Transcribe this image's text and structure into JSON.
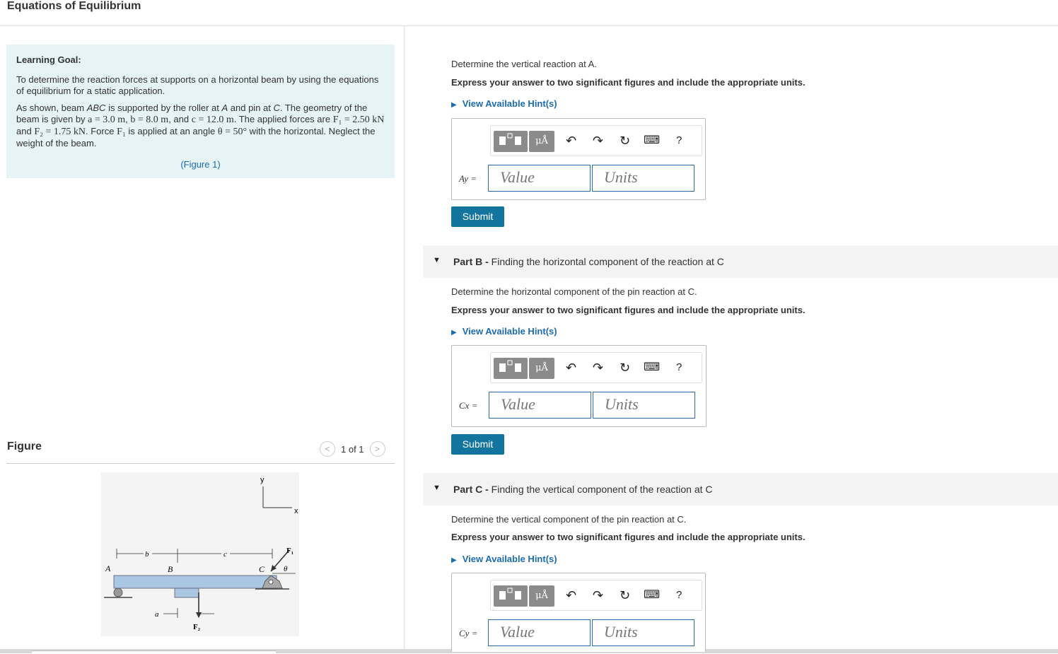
{
  "page_title": "Equations of Equilibrium",
  "learning_goal": {
    "heading": "Learning Goal:",
    "paragraph1": "To determine the reaction forces at supports on a horizontal beam by using the equations of equilibrium for a static application.",
    "p2_a": "As shown, beam ",
    "p2_abc": "ABC",
    "p2_b": " is supported by the roller at ",
    "p2_A": "A",
    "p2_c": " and pin at ",
    "p2_C": "C",
    "p2_d": ". The geometry of the beam is given by ",
    "p2_a_val": "a = 3.0 m",
    "p2_sep1": ", ",
    "p2_b_val": "b = 8.0 m",
    "p2_and": ", and ",
    "p2_c_val": "c = 12.0 m",
    "p2_e": ". The applied forces are ",
    "p2_F1": "F₁ = 2.50 kN",
    "p2_and2": " and ",
    "p2_F2": "F₂ = 1.75 kN",
    "p2_f": ". Force ",
    "p2_F1b": "F₁",
    "p2_g": " is applied at an angle ",
    "p2_theta": "θ = 50°",
    "p2_h": " with the horizontal. Neglect the weight of the beam.",
    "figure_link": "(Figure 1)"
  },
  "figure": {
    "label": "Figure",
    "counter": "1 of 1",
    "prev_glyph": "<",
    "next_glyph": ">",
    "diagram_labels": {
      "y": "y",
      "x": "x",
      "b": "b",
      "c": "c",
      "F1": "F₁",
      "A": "A",
      "B": "B",
      "C": "C",
      "theta": "θ",
      "a": "a",
      "F2": "F₂"
    }
  },
  "toolbar": {
    "mu_label": "μÅ",
    "undo": "↶",
    "redo": "↷",
    "reset": "↻",
    "keyboard": "⌨",
    "help": "?"
  },
  "part_a": {
    "question": "Determine the vertical reaction at A.",
    "instruction": "Express your answer to two significant figures and include the appropriate units.",
    "hint": "View Available Hint(s)",
    "var_label": "Ay =",
    "value_placeholder": "Value",
    "units_placeholder": "Units",
    "submit": "Submit"
  },
  "part_b": {
    "header_bold": "Part B -",
    "header_text": " Finding the horizontal component of the reaction at C",
    "question": "Determine the horizontal component of the pin reaction at C.",
    "instruction": "Express your answer to two significant figures and include the appropriate units.",
    "hint": "View Available Hint(s)",
    "var_label": "Cx =",
    "value_placeholder": "Value",
    "units_placeholder": "Units",
    "submit": "Submit"
  },
  "part_c": {
    "header_bold": "Part C -",
    "header_text": " Finding the vertical component of the reaction at C",
    "question": "Determine the vertical component of the pin reaction at C.",
    "instruction": "Express your answer to two significant figures and include the appropriate units.",
    "hint": "View Available Hint(s)",
    "var_label": "Cy =",
    "value_placeholder": "Value",
    "units_placeholder": "Units"
  }
}
